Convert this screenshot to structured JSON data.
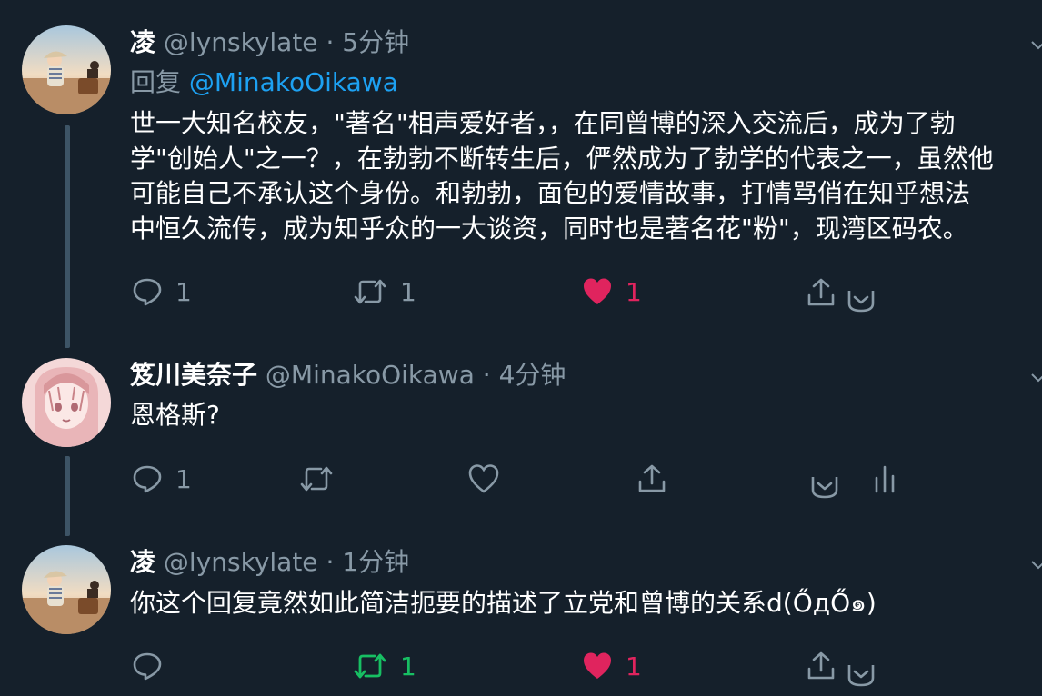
{
  "tweets": [
    {
      "author_name": "凌",
      "handle": "@lynskylate",
      "separator": "·",
      "time": "5分钟",
      "reply_label": "回复",
      "reply_mention": "@MinakoOikawa",
      "text": "世一大知名校友，\"著名\"相声爱好者，，在同曾博的深入交流后，成为了勃\n学\"创始人\"之一？，在勃勃不断转生后，俨然成为了勃学的代表之一，虽然他\n可能自己不承认这个身份。和勃勃，面包的爱情故事，打情骂俏在知乎想法\n中恒久流传，成为知乎众的一大谈资，同时也是著名花\"粉\"，现湾区码农。",
      "reply_count": "1",
      "retweet_count": "1",
      "like_count": "1"
    },
    {
      "author_name": "笈川美奈子",
      "handle": "@MinakoOikawa",
      "separator": "·",
      "time": "4分钟",
      "text": "恩格斯?",
      "reply_count": "1"
    },
    {
      "author_name": "凌",
      "handle": "@lynskylate",
      "separator": "·",
      "time": "1分钟",
      "text": "你这个回复竟然如此简洁扼要的描述了立党和曾博的关系d(ŐдŐ๑)",
      "retweet_count": "1",
      "like_count": "1"
    }
  ],
  "colors": {
    "background": "#15202b",
    "secondary_text": "#8899a6",
    "link": "#1da1f2",
    "like": "#e0245e",
    "retweet_active": "#17bf63"
  },
  "icons": [
    "reply-icon",
    "retweet-icon",
    "heart-icon",
    "share-icon",
    "chevron-down-icon",
    "analytics-icon"
  ]
}
